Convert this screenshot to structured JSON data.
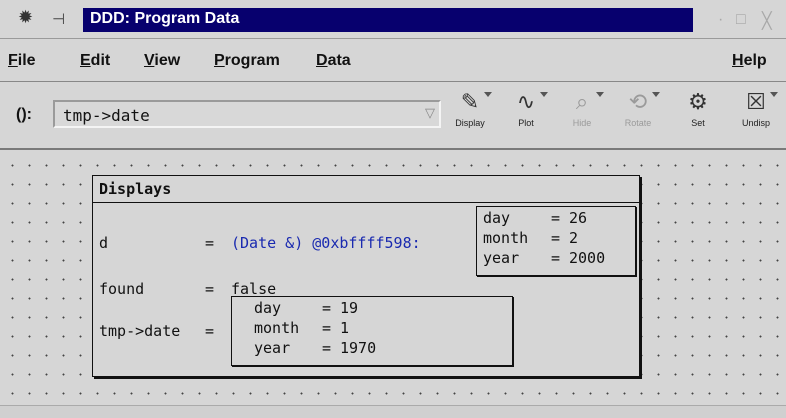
{
  "window": {
    "title": "DDD: Program Data",
    "minimize": "·",
    "maximize": "□",
    "close": "╳"
  },
  "menu": {
    "file": {
      "first": "F",
      "rest": "ile"
    },
    "edit": {
      "first": "E",
      "rest": "dit"
    },
    "view": {
      "first": "V",
      "rest": "iew"
    },
    "program": {
      "first": "P",
      "rest": "rogram"
    },
    "data": {
      "first": "D",
      "rest": "ata"
    },
    "help": {
      "first": "H",
      "rest": "elp"
    }
  },
  "toolbar": {
    "arg_label": "():",
    "arg_value": "tmp->date",
    "buttons": [
      {
        "label": "Display",
        "icon": "display-icon",
        "enabled": true
      },
      {
        "label": "Plot",
        "icon": "plot-icon",
        "enabled": true
      },
      {
        "label": "Hide",
        "icon": "hide-icon",
        "enabled": false
      },
      {
        "label": "Rotate",
        "icon": "rotate-icon",
        "enabled": false
      },
      {
        "label": "Set",
        "icon": "set-icon",
        "enabled": true
      },
      {
        "label": "Undisp",
        "icon": "undisp-icon",
        "enabled": true
      }
    ]
  },
  "displays": {
    "title": "Displays",
    "d": {
      "name": "d",
      "eq": "=",
      "value": "(Date &) @0xbffff598:",
      "fields": [
        {
          "name": "day",
          "value": "26"
        },
        {
          "name": "month",
          "value": "2"
        },
        {
          "name": "year",
          "value": "2000"
        }
      ]
    },
    "found": {
      "name": "found",
      "eq": "=",
      "value": "false"
    },
    "tmp_date": {
      "name": "tmp->date",
      "eq": "=",
      "fields": [
        {
          "name": "day",
          "value": "19"
        },
        {
          "name": "month",
          "value": "1"
        },
        {
          "name": "year",
          "value": "1970"
        }
      ]
    }
  },
  "colors": {
    "title_bar": "#07006e",
    "pointer_value": "#1a2ab0",
    "background": "#d6d6d6"
  }
}
